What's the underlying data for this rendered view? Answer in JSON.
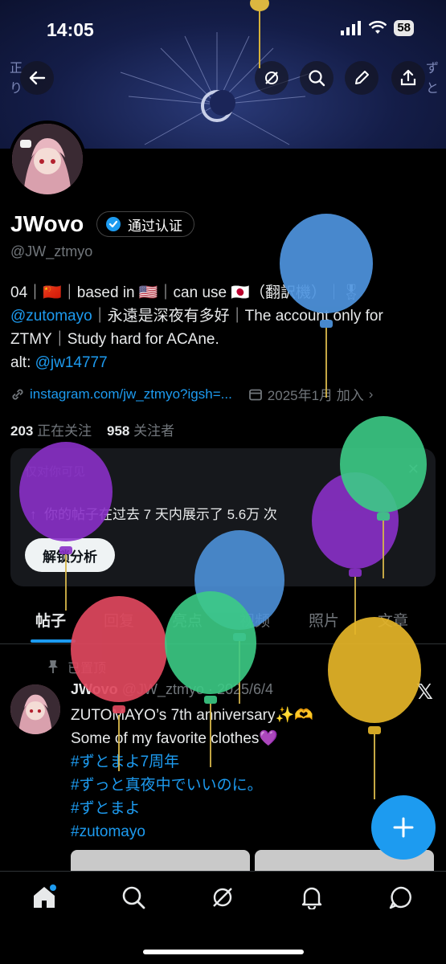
{
  "status": {
    "time": "14:05",
    "battery": "58"
  },
  "profile": {
    "name": "JWovo",
    "verified_label": "通过认证",
    "handle": "@JW_ztmyo",
    "bio_line1": "04｜🇨🇳｜based in 🇺🇸｜can use 🇯🇵（翻訳機）｜🎖",
    "bio_mention": "@zutomayo",
    "bio_line2_rest": "｜永遠是深夜有多好｜The account only for",
    "bio_line3": "ZTMY｜Study hard for ACAne.",
    "bio_alt_label": "alt: ",
    "bio_alt_link": "@jw14777",
    "url": "instagram.com/jw_ztmyo?igsh=...",
    "joined": "2025年1月 加入",
    "following_count": "203",
    "following_label": "正在关注",
    "followers_count": "958",
    "followers_label": "关注者"
  },
  "analytics": {
    "visibility": "仅对你可见",
    "stat": "你的帖子在过去 7 天内展示了 5.6万 次",
    "button": "解锁分析"
  },
  "tabs": [
    {
      "label": "帖子"
    },
    {
      "label": "回复"
    },
    {
      "label": "亮点"
    },
    {
      "label": "视频"
    },
    {
      "label": "照片"
    },
    {
      "label": "文章"
    }
  ],
  "post": {
    "pinned_label": "已置顶",
    "author": "JWovo",
    "handle_date": "@JW_ztmyo · 2025/6/4",
    "line1": "ZUTOMAYO’s 7th anniversary✨🫶",
    "line2": "Some of my favorite clothes💜",
    "tags": [
      "#ずとまよ7周年",
      "#ずっと真夜中でいいのに。",
      "#ずとまよ",
      "#zutomayo"
    ]
  },
  "icons": {
    "back": "arrow-left-icon",
    "grok": "grok-icon",
    "search": "search-icon",
    "edit": "pencil-icon",
    "share": "share-icon",
    "verified": "verified-badge-icon",
    "link": "link-icon",
    "calendar": "calendar-icon",
    "pin": "pin-icon",
    "x": "x-logo-icon",
    "compose": "plus-icon",
    "home": "home-icon",
    "notifications": "bell-icon",
    "messages": "message-icon"
  },
  "colors": {
    "accent": "#1d9bf0",
    "background": "#000000"
  }
}
